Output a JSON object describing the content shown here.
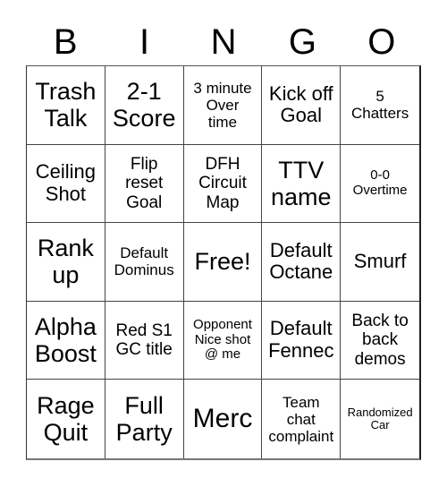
{
  "header": {
    "letters": [
      "B",
      "I",
      "N",
      "G",
      "O"
    ]
  },
  "board": {
    "cells": [
      "Trash\nTalk",
      "2-1\nScore",
      "3 minute\nOver\ntime",
      "Kick off\nGoal",
      "5\nChatters",
      "Ceiling\nShot",
      "Flip\nreset\nGoal",
      "DFH\nCircuit\nMap",
      "TTV\nname",
      "0-0\nOvertime",
      "Rank\nup",
      "Default\nDominus",
      "Free!",
      "Default\nOctane",
      "Smurf",
      "Alpha\nBoost",
      "Red S1\nGC title",
      "Opponent\nNice shot\n@ me",
      "Default\nFennec",
      "Back to\nback\ndemos",
      "Rage\nQuit",
      "Full\nParty",
      "Merc",
      "Team\nchat\ncomplaint",
      "Randomized\nCar"
    ]
  }
}
